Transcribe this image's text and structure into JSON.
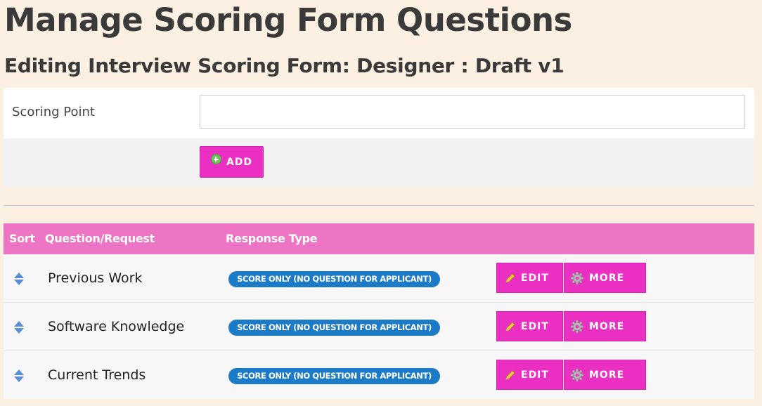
{
  "page": {
    "title": "Manage Scoring Form Questions",
    "subtitle": "Editing Interview Scoring Form: Designer : Draft v1"
  },
  "form": {
    "field_label": "Scoring Point",
    "field_value": "",
    "field_placeholder": "",
    "add_label": "ADD",
    "add_icon": "plus-circle-icon"
  },
  "table": {
    "headers": {
      "sort": "Sort",
      "question": "Question/Request",
      "response_type": "Response Type"
    },
    "rows": [
      {
        "question": "Previous Work",
        "response_type": "SCORE ONLY (NO QUESTION FOR APPLICANT)",
        "edit_label": "EDIT",
        "more_label": "MORE"
      },
      {
        "question": "Software Knowledge",
        "response_type": "SCORE ONLY (NO QUESTION FOR APPLICANT)",
        "edit_label": "EDIT",
        "more_label": "MORE"
      },
      {
        "question": "Current Trends",
        "response_type": "SCORE ONLY (NO QUESTION FOR APPLICANT)",
        "edit_label": "EDIT",
        "more_label": "MORE"
      }
    ]
  },
  "colors": {
    "background": "#fbf0e1",
    "accent_button": "#ea2fc2",
    "table_header": "#ee75c3",
    "badge": "#1c7bc6"
  },
  "icons": {
    "sort": "sort-arrows-icon",
    "edit": "pencil-icon",
    "more": "gear-icon"
  }
}
